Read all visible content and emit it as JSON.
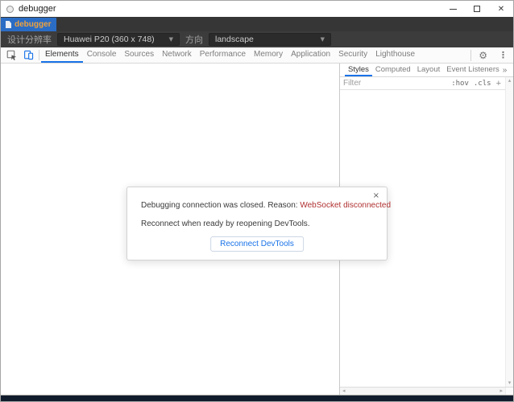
{
  "window": {
    "title": "debugger"
  },
  "icons": {
    "close_window": "✕",
    "dropdown": "▼",
    "gear": "⚙",
    "more_menu": "⋮",
    "more_tabs": "»",
    "plus": "+",
    "scroll_up": "▴",
    "scroll_down": "▾",
    "scroll_left": "◂",
    "scroll_right": "▸",
    "dialog_close": "×"
  },
  "tabstrip": {
    "tab_label": "debugger"
  },
  "toolbar": {
    "resolution_label": "设计分辨率",
    "resolution_value": "Huawei P20 (360 x 748)",
    "orientation_label": "方向",
    "orientation_value": "landscape"
  },
  "devtools": {
    "tabs": [
      "Elements",
      "Console",
      "Sources",
      "Network",
      "Performance",
      "Memory",
      "Application",
      "Security",
      "Lighthouse"
    ],
    "active_tab": "Elements",
    "sidebar_tabs": [
      "Styles",
      "Computed",
      "Layout",
      "Event Listeners"
    ],
    "sidebar_active_tab": "Styles",
    "filter_placeholder": "Filter",
    "state_toggle_label": ":hov",
    "class_toggle_label": ".cls"
  },
  "dialog": {
    "message_prefix": "Debugging connection was closed. Reason: ",
    "reason": "WebSocket disconnected",
    "line2": "Reconnect when ready by reopening DevTools.",
    "button_label": "Reconnect DevTools"
  },
  "colors": {
    "accent_blue": "#1a73e8",
    "app_tab_blue": "#2b6cc4",
    "app_tab_text_orange": "#efa23e",
    "reason_red": "#b03030",
    "dark_toolbar": "#3c3c3c",
    "tabstrip_bg": "#363636",
    "bottom_strip_navy": "#101c2c"
  }
}
